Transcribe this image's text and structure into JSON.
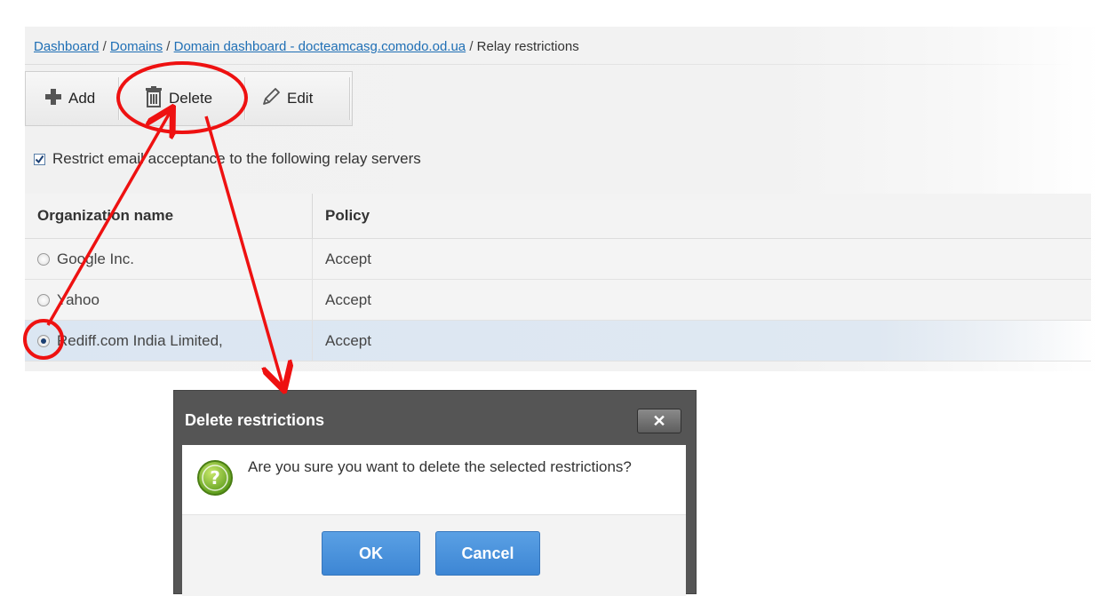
{
  "breadcrumb": {
    "items": [
      "Dashboard",
      "Domains",
      "Domain dashboard - docteamcasg.comodo.od.ua"
    ],
    "current": "Relay restrictions",
    "separator": "/"
  },
  "toolbar": {
    "add_label": "Add",
    "delete_label": "Delete",
    "edit_label": "Edit"
  },
  "restrict_option": {
    "label": "Restrict email acceptance to the following relay servers",
    "checked": true
  },
  "table": {
    "headers": [
      "Organization name",
      "Policy"
    ],
    "rows": [
      {
        "name": "Google Inc.",
        "policy": "Accept",
        "selected": false
      },
      {
        "name": "Yahoo",
        "policy": "Accept",
        "selected": false
      },
      {
        "name": "Rediff.com India Limited,",
        "policy": "Accept",
        "selected": true
      }
    ]
  },
  "dialog": {
    "title": "Delete restrictions",
    "close_symbol": "✕",
    "message": "Are you sure you want to delete the selected restrictions?",
    "icon_glyph": "?",
    "ok_label": "OK",
    "cancel_label": "Cancel"
  },
  "colors": {
    "link": "#1f6fb5",
    "button": "#4a90dc",
    "annotation": "#ee1111",
    "dialog_frame": "#555555"
  }
}
